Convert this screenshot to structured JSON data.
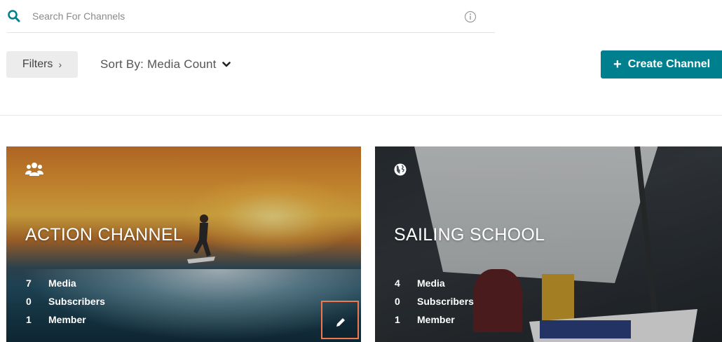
{
  "search": {
    "placeholder": "Search For Channels",
    "value": "",
    "icon": "search-icon",
    "info_icon": "info-icon"
  },
  "toolbar": {
    "filters_label": "Filters",
    "filters_chevron": "›",
    "sort_label": "Sort By: Media Count",
    "create_label": "Create Channel",
    "create_plus": "+"
  },
  "colors": {
    "accent": "#00808f",
    "highlight": "#f0784a"
  },
  "channels": [
    {
      "title": "ACTION CHANNEL",
      "type_icon": "group-icon",
      "stats": [
        {
          "count": "7",
          "label": "Media"
        },
        {
          "count": "0",
          "label": "Subscribers"
        },
        {
          "count": "1",
          "label": "Member"
        }
      ],
      "edit_icon": "pencil-icon"
    },
    {
      "title": "SAILING SCHOOL",
      "type_icon": "globe-icon",
      "stats": [
        {
          "count": "4",
          "label": "Media"
        },
        {
          "count": "0",
          "label": "Subscribers"
        },
        {
          "count": "1",
          "label": "Member"
        }
      ]
    }
  ]
}
